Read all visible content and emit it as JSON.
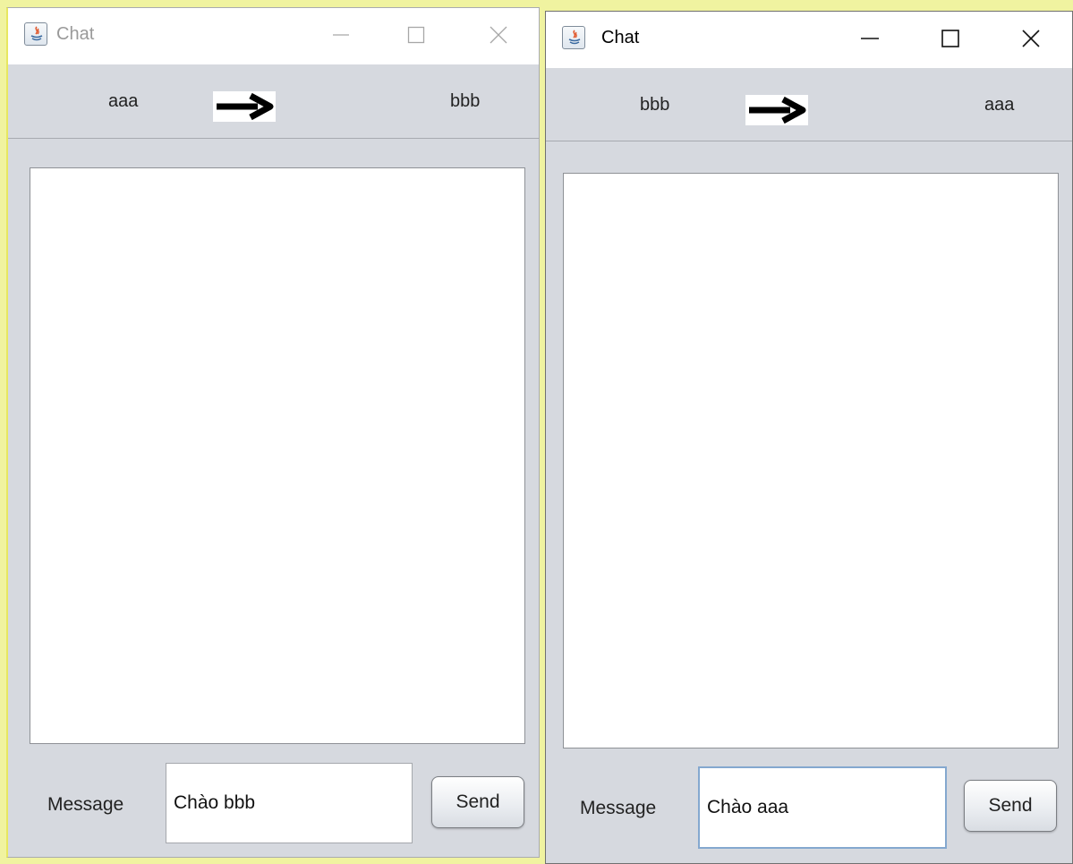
{
  "windows": [
    {
      "title": "Chat",
      "active": false,
      "from_user": "aaa",
      "to_user": "bbb",
      "message_label": "Message",
      "message_value": "Chào bbb",
      "send_label": "Send"
    },
    {
      "title": "Chat",
      "active": true,
      "from_user": "bbb",
      "to_user": "aaa",
      "message_label": "Message",
      "message_value": "Chào aaa",
      "send_label": "Send"
    }
  ],
  "icons": {
    "app": "java-app-icon",
    "minimize": "minimize-icon",
    "maximize": "maximize-icon",
    "close": "close-icon",
    "arrow": "right-arrow-icon"
  },
  "colors": {
    "window_bg": "#d6d9df",
    "titlebar_bg": "#ffffff",
    "focus_border": "#84a8cf"
  }
}
